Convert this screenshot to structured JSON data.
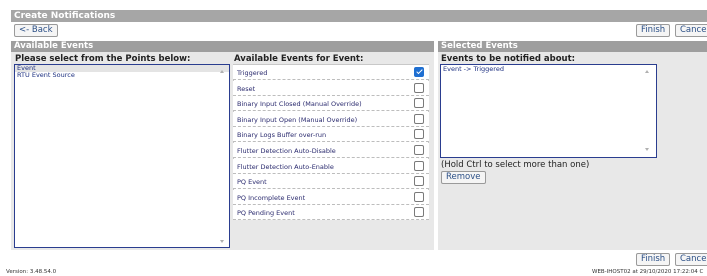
{
  "window": {
    "title": "Create Notifications"
  },
  "toolbar": {
    "back_label": "<- Back",
    "finish_label": "Finish",
    "cancel_label": "Cancel"
  },
  "available": {
    "header": "Available Events",
    "points_label": "Please select from the Points below:",
    "points": [
      "Event",
      "RTU Event Source"
    ],
    "events_label": "Available Events for Event:",
    "events": [
      {
        "label": "Triggered",
        "checked": true
      },
      {
        "label": "Reset",
        "checked": false
      },
      {
        "label": "Binary Input Closed (Manual Override)",
        "checked": false
      },
      {
        "label": "Binary Input Open (Manual Override)",
        "checked": false
      },
      {
        "label": "Binary Logs Buffer over-run",
        "checked": false
      },
      {
        "label": "Flutter Detection Auto-Disable",
        "checked": false
      },
      {
        "label": "Flutter Detection Auto-Enable",
        "checked": false
      },
      {
        "label": "PQ Event",
        "checked": false
      },
      {
        "label": "PQ Incomplete Event",
        "checked": false
      },
      {
        "label": "PQ Pending Event",
        "checked": false
      }
    ]
  },
  "selected": {
    "header": "Selected Events",
    "notify_label": "Events to be notified about:",
    "items": [
      "Event -> Triggered"
    ],
    "hint": "(Hold Ctrl to select more than one)",
    "remove_label": "Remove"
  },
  "footer": {
    "version": "Version: 3.48.54.0",
    "host": "WEB-IHOST02 at 29/10/2020 17:22:04 C"
  },
  "colors": {
    "header_bg": "#9e9e9e",
    "title_bg": "#a6a6a6",
    "link_blue": "#2b4f86",
    "check_blue": "#1f6fd1"
  },
  "icons": [
    "checkmark-icon",
    "scroll-up-icon",
    "scroll-down-icon"
  ]
}
